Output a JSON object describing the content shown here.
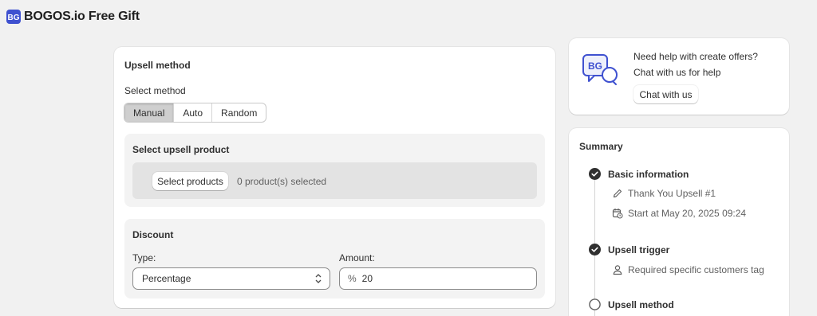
{
  "app": {
    "title": "BOGOS.io Free Gift",
    "logo_icon": "bogos-logo-icon"
  },
  "upsell_method": {
    "title": "Upsell method",
    "select_label": "Select method",
    "methods": [
      {
        "label": "Manual",
        "active": true
      },
      {
        "label": "Auto",
        "active": false
      },
      {
        "label": "Random",
        "active": false
      }
    ]
  },
  "upsell_product": {
    "title": "Select upsell product",
    "button_label": "Select products",
    "selected_text": "0 product(s) selected"
  },
  "discount": {
    "title": "Discount",
    "type_label": "Type:",
    "type_value": "Percentage",
    "amount_label": "Amount:",
    "amount_prefix": "%",
    "amount_value": "20"
  },
  "help": {
    "line1": "Need help with create offers?",
    "line2": "Chat with us for help",
    "button_label": "Chat with us"
  },
  "summary": {
    "title": "Summary",
    "steps": [
      {
        "title": "Basic information",
        "status": "completed",
        "details": [
          {
            "icon": "pencil-icon",
            "text": "Thank You Upsell #1"
          },
          {
            "icon": "calendar-clock-icon",
            "text": "Start at May 20, 2025 09:24"
          }
        ]
      },
      {
        "title": "Upsell trigger",
        "status": "completed",
        "details": [
          {
            "icon": "person-icon",
            "text": "Required specific customers tag"
          }
        ]
      },
      {
        "title": "Upsell method",
        "status": "incomplete",
        "details": []
      }
    ]
  },
  "colors": {
    "accent": "#3f51d0",
    "active_segment": "#cfcfcf",
    "background": "#f1f1f1"
  }
}
